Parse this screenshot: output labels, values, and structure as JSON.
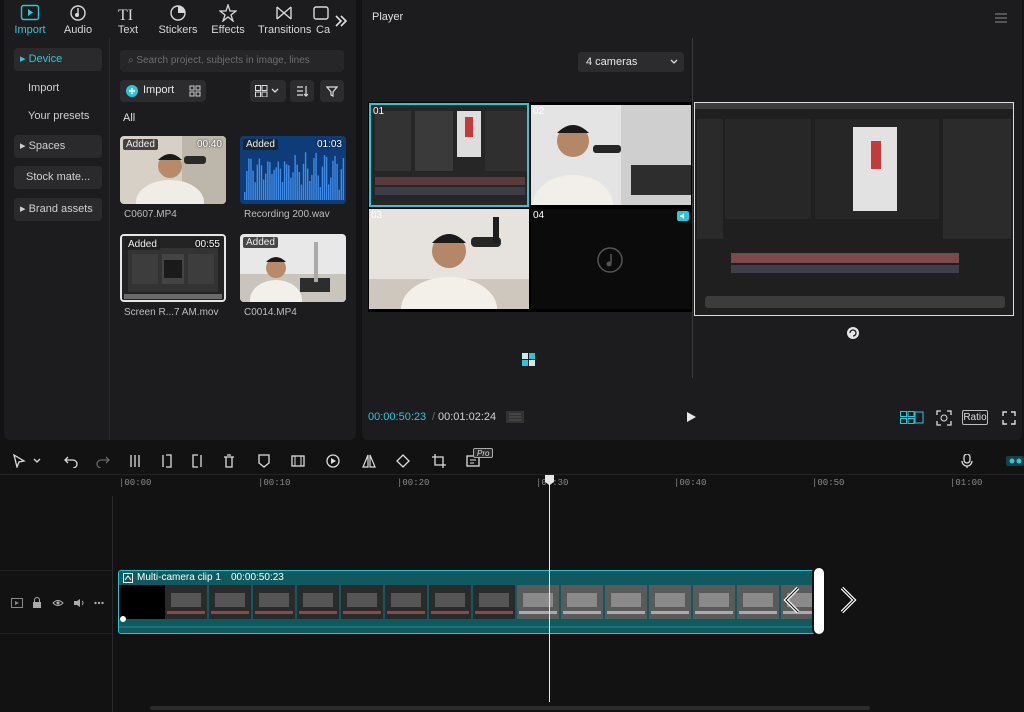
{
  "top_tabs": [
    {
      "label": "Import",
      "icon": "import-icon",
      "active": true
    },
    {
      "label": "Audio",
      "icon": "audio-icon"
    },
    {
      "label": "Text",
      "icon": "text-icon"
    },
    {
      "label": "Stickers",
      "icon": "stickers-icon"
    },
    {
      "label": "Effects",
      "icon": "effects-icon"
    },
    {
      "label": "Transitions",
      "icon": "transitions-icon"
    },
    {
      "label": "Ca",
      "icon": "captions-icon"
    }
  ],
  "left_nav": {
    "device": "Device",
    "import": "Import",
    "your_presets": "Your presets",
    "spaces": "Spaces",
    "stock_materials": "Stock mate...",
    "brand_assets": "Brand assets"
  },
  "search": {
    "placeholder": "Search project, subjects in image, lines"
  },
  "import_button": "Import",
  "filter_all": "All",
  "media": [
    {
      "name": "C0607.MP4",
      "badge": "Added",
      "duration": "00:40"
    },
    {
      "name": "Recording 200.wav",
      "badge": "Added",
      "duration": "01:03"
    },
    {
      "name": "Screen R...7 AM.mov",
      "badge": "Added",
      "duration": "00:55"
    },
    {
      "name": "C0014.MP4",
      "badge": "Added",
      "duration": ""
    }
  ],
  "player": {
    "title": "Player",
    "camera_select": "4 cameras",
    "cams": [
      "01",
      "02",
      "03",
      "04"
    ],
    "current_time": "00:00:50:23",
    "total_time": "00:01:02:24",
    "ratio_label": "Ratio"
  },
  "toolbar": {
    "pro_badge": "Pro"
  },
  "ruler": [
    "|00:00",
    "|00:10",
    "|00:20",
    "|00:30",
    "|00:40",
    "|00:50",
    "|01:00"
  ],
  "clip": {
    "name": "Multi-camera clip 1",
    "duration": "00:00:50:23"
  },
  "colors": {
    "accent": "#2bc7d8",
    "clip_bg": "#0f5a60",
    "clip_border": "#27c2cc"
  }
}
